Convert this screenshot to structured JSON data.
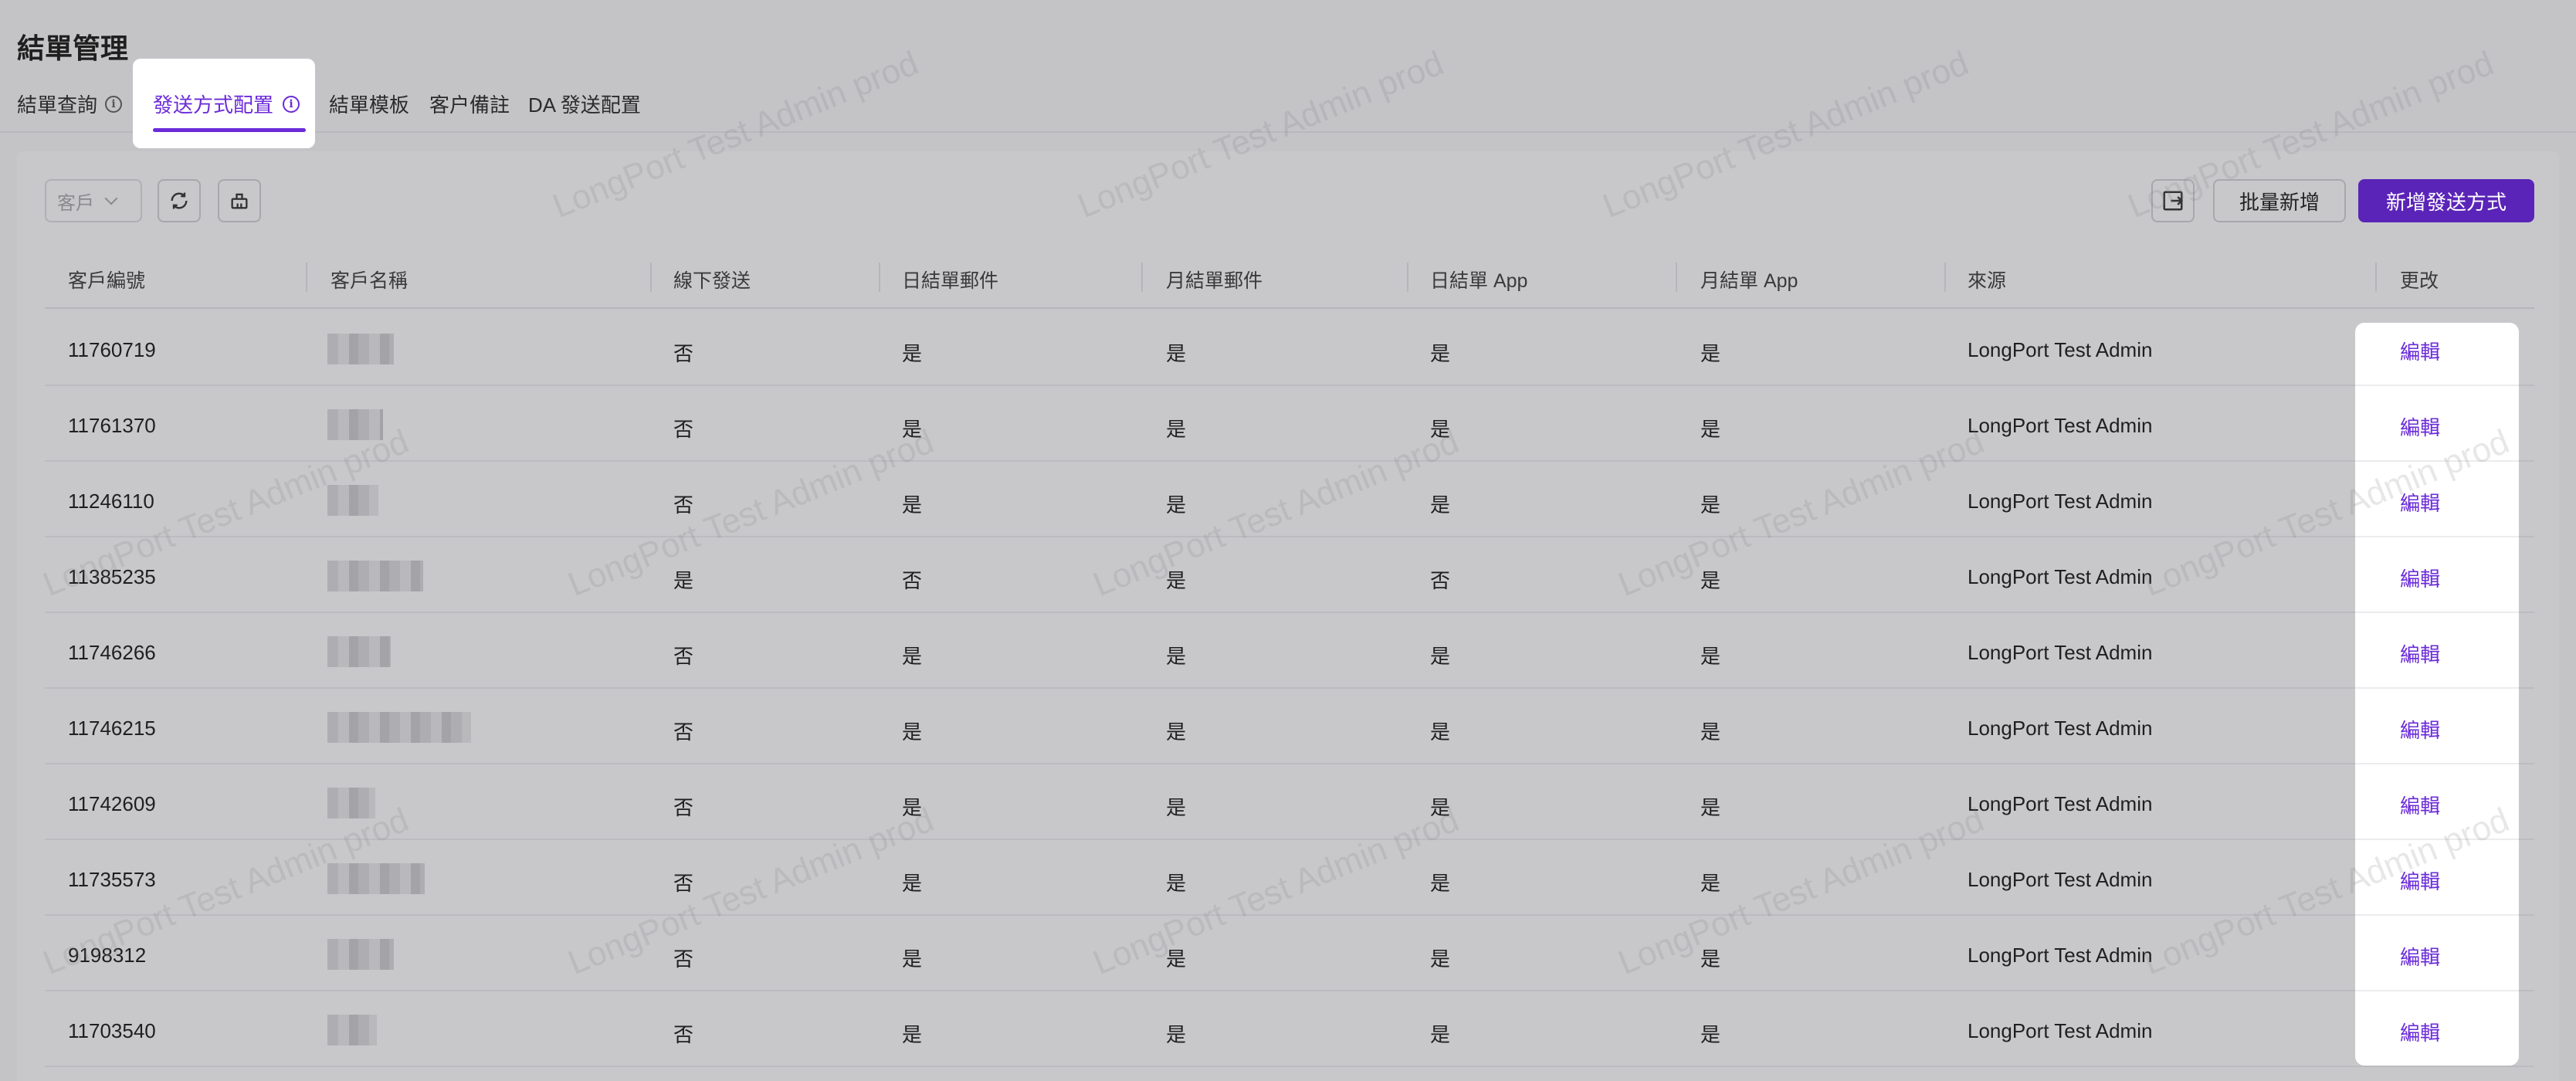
{
  "page_title": "結單管理",
  "tabs": [
    {
      "label": "結單查詢",
      "has_info": true
    },
    {
      "label": "發送方式配置",
      "has_info": true,
      "active": true
    },
    {
      "label": "結單模板"
    },
    {
      "label": "客户備註"
    },
    {
      "label": "DA 發送配置"
    }
  ],
  "toolbar": {
    "filter_select": "客戶",
    "export_icon": "export-icon",
    "batch_add_label": "批量新增",
    "add_label": "新增發送方式"
  },
  "columns": [
    "客戶編號",
    "客戶名稱",
    "線下發送",
    "日結單郵件",
    "月結單郵件",
    "日結單 App",
    "月結單 App",
    "來源",
    "更改"
  ],
  "rows": [
    {
      "id": "11760719",
      "offline": "否",
      "daily_email": "是",
      "monthly_email": "是",
      "daily_app": "是",
      "monthly_app": "是",
      "source": "LongPort Test Admin",
      "action": "編輯"
    },
    {
      "id": "11761370",
      "offline": "否",
      "daily_email": "是",
      "monthly_email": "是",
      "daily_app": "是",
      "monthly_app": "是",
      "source": "LongPort Test Admin",
      "action": "編輯"
    },
    {
      "id": "11246110",
      "offline": "否",
      "daily_email": "是",
      "monthly_email": "是",
      "daily_app": "是",
      "monthly_app": "是",
      "source": "LongPort Test Admin",
      "action": "編輯"
    },
    {
      "id": "11385235",
      "offline": "是",
      "daily_email": "否",
      "monthly_email": "是",
      "daily_app": "否",
      "monthly_app": "是",
      "source": "LongPort Test Admin",
      "action": "編輯"
    },
    {
      "id": "11746266",
      "offline": "否",
      "daily_email": "是",
      "monthly_email": "是",
      "daily_app": "是",
      "monthly_app": "是",
      "source": "LongPort Test Admin",
      "action": "編輯"
    },
    {
      "id": "11746215",
      "offline": "否",
      "daily_email": "是",
      "monthly_email": "是",
      "daily_app": "是",
      "monthly_app": "是",
      "source": "LongPort Test Admin",
      "action": "編輯"
    },
    {
      "id": "11742609",
      "offline": "否",
      "daily_email": "是",
      "monthly_email": "是",
      "daily_app": "是",
      "monthly_app": "是",
      "source": "LongPort Test Admin",
      "action": "編輯"
    },
    {
      "id": "11735573",
      "offline": "否",
      "daily_email": "是",
      "monthly_email": "是",
      "daily_app": "是",
      "monthly_app": "是",
      "source": "LongPort Test Admin",
      "action": "編輯"
    },
    {
      "id": "9198312",
      "offline": "否",
      "daily_email": "是",
      "monthly_email": "是",
      "daily_app": "是",
      "monthly_app": "是",
      "source": "LongPort Test Admin",
      "action": "編輯"
    },
    {
      "id": "11703540",
      "offline": "否",
      "daily_email": "是",
      "monthly_email": "是",
      "daily_app": "是",
      "monthly_app": "是",
      "source": "LongPort Test Admin",
      "action": "編輯"
    }
  ],
  "watermark": "LongPort Test Admin prod"
}
